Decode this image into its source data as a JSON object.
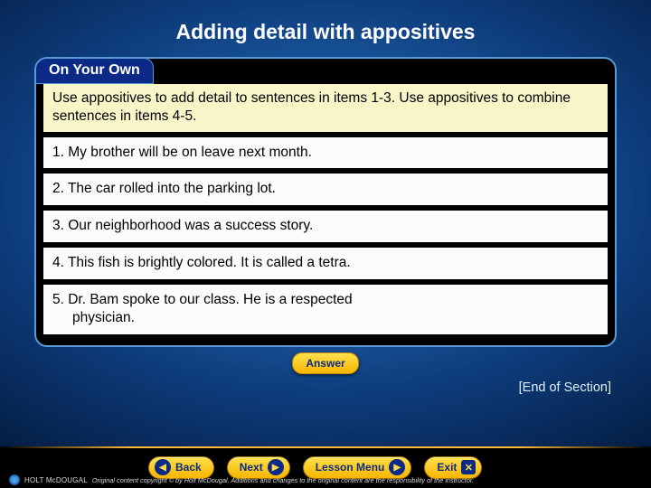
{
  "title": "Adding detail with appositives",
  "subhead": "On Your Own",
  "intro": "Use appositives to add detail to sentences in items 1-3. Use appositives to combine sentences in items 4-5.",
  "items": [
    "1. My brother will be on leave next month.",
    "2. The car rolled into the parking lot.",
    "3. Our neighborhood was a success story.",
    "4. This fish is brightly colored. It is called a tetra."
  ],
  "item5_line1": "5. Dr. Bam spoke to our class. He is a respected",
  "item5_line2": "physician.",
  "answer_label": "Answer",
  "end_label": "[End of Section]",
  "nav": {
    "back": "Back",
    "next": "Next",
    "menu": "Lesson Menu",
    "exit": "Exit"
  },
  "brand_html": "HOLT McDOUGAL",
  "copyright": "Original content copyright © by Holt McDougal. Additions and changes to the original content are the responsibility of the instructor."
}
